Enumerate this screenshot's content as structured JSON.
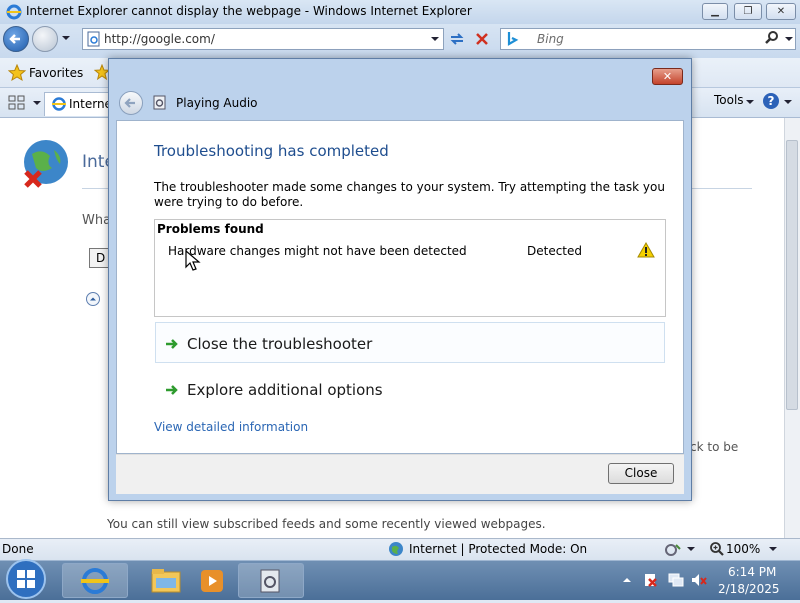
{
  "browser": {
    "window_title": "Internet Explorer cannot display the webpage - Windows Internet Explorer",
    "address": "http://google.com/",
    "search_placeholder": "Bing",
    "favorites_label": "Favorites",
    "tab_label": "Internet",
    "tools_label": "Tools",
    "page_heading": "Inte",
    "page_what": "Wha",
    "page_detail_button": "D",
    "page_right_fragment": "ck to be",
    "page_bottom_text": "You can still view subscribed feeds and some recently viewed webpages.",
    "status_left": "Done",
    "status_zone": "Internet | Protected Mode: On",
    "zoom": "100%"
  },
  "dialog": {
    "title": "Playing Audio",
    "heading": "Troubleshooting has completed",
    "description": "The troubleshooter made some changes to your system. Try attempting the task you were trying to do before.",
    "problems_header": "Problems found",
    "problems": [
      {
        "name": "Hardware changes might not have been detected",
        "status": "Detected"
      }
    ],
    "options": [
      {
        "label": "Close the troubleshooter"
      },
      {
        "label": "Explore additional options"
      }
    ],
    "detail_link": "View detailed information",
    "close_button": "Close"
  },
  "taskbar": {
    "time": "6:14 PM",
    "date": "2/18/2025"
  },
  "colors": {
    "heading_blue": "#1f4e8f",
    "link_blue": "#2a66b4",
    "arrow_green": "#2e9b2e",
    "warning_yellow": "#f5d000"
  }
}
